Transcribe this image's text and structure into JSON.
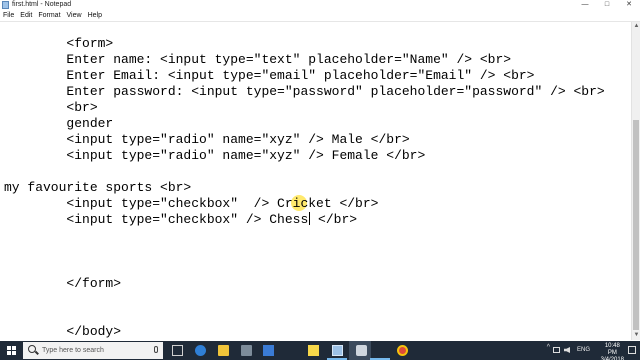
{
  "window": {
    "title": "first.html - Notepad",
    "controls": {
      "minimize": "—",
      "maximize": "□",
      "close": "✕"
    }
  },
  "menu": {
    "items": [
      "File",
      "Edit",
      "Format",
      "View",
      "Help"
    ]
  },
  "editor": {
    "lines": [
      "        <form>",
      "        Enter name: <input type=\"text\" placeholder=\"Name\" /> <br>",
      "        Enter Email: <input type=\"email\" placeholder=\"Email\" /> <br>",
      "        Enter password: <input type=\"password\" placeholder=\"password\" /> <br>",
      "        <br>",
      "        gender",
      "        <input type=\"radio\" name=\"xyz\" /> Male </br>",
      "        <input type=\"radio\" name=\"xyz\" /> Female </br>",
      "",
      "my favourite sports <br>",
      "        <input type=\"checkbox\"  /> Cricket </br>",
      "        <input type=\"checkbox\" /> Chess",
      "",
      "",
      "",
      "        </form>",
      "",
      "",
      "        </body>"
    ],
    "caret_line_tail": " </br>"
  },
  "taskbar": {
    "search_placeholder": "Type here to search",
    "tray": {
      "language": "ENG",
      "time": "10:48 PM",
      "date": "3/4/2018"
    },
    "icons": [
      "task-view-icon",
      "edge-icon",
      "file-explorer-icon",
      "store-icon",
      "mail-icon",
      "sticky-notes-icon",
      "notepad-icon",
      "settings-icon",
      "chrome-icon"
    ]
  }
}
